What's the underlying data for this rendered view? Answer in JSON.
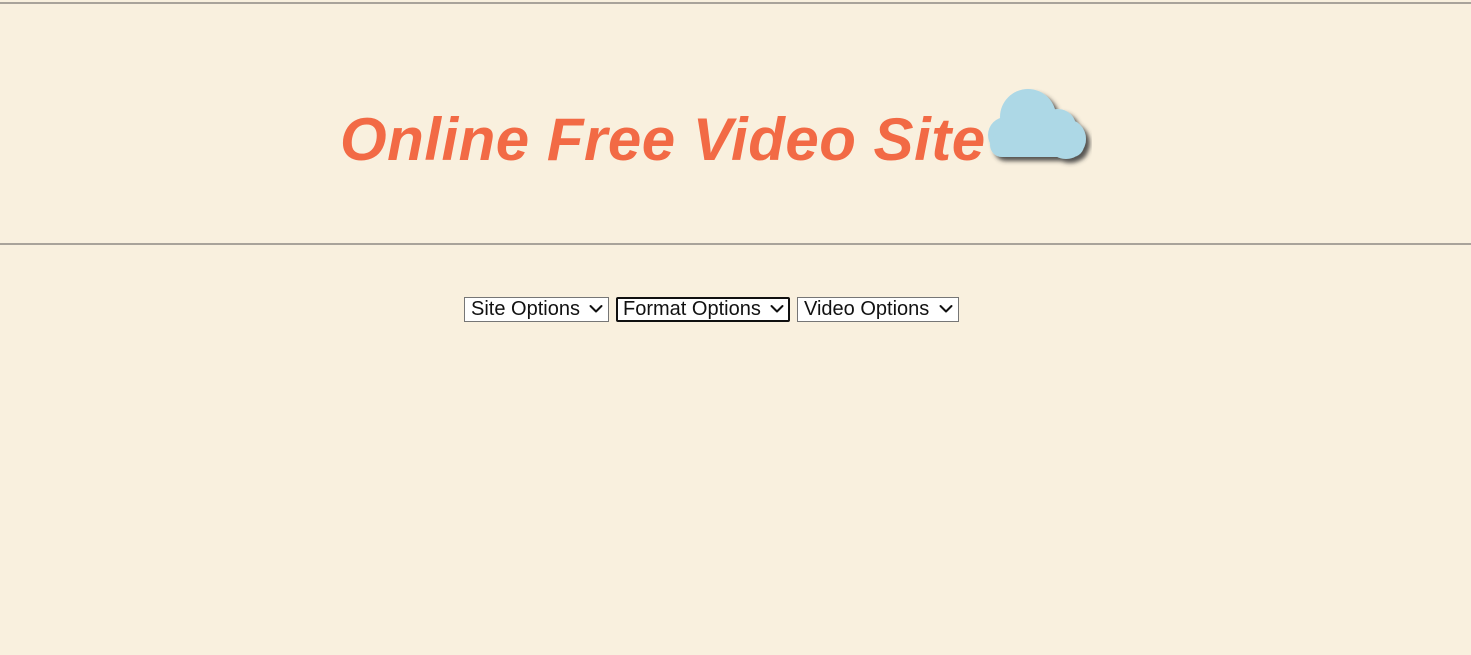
{
  "header": {
    "title": "Online Free Video Site",
    "logo_icon": "cloud-icon",
    "title_color": "#f26a45",
    "cloud_color": "#add8e6"
  },
  "options": {
    "site": {
      "label": "Site Options",
      "icon": "chevron-down-icon"
    },
    "format": {
      "label": "Format Options",
      "icon": "chevron-down-icon",
      "focused": true
    },
    "video": {
      "label": "Video Options",
      "icon": "chevron-down-icon"
    }
  },
  "colors": {
    "background": "#f9f0de",
    "rule": "#a9a39a"
  }
}
